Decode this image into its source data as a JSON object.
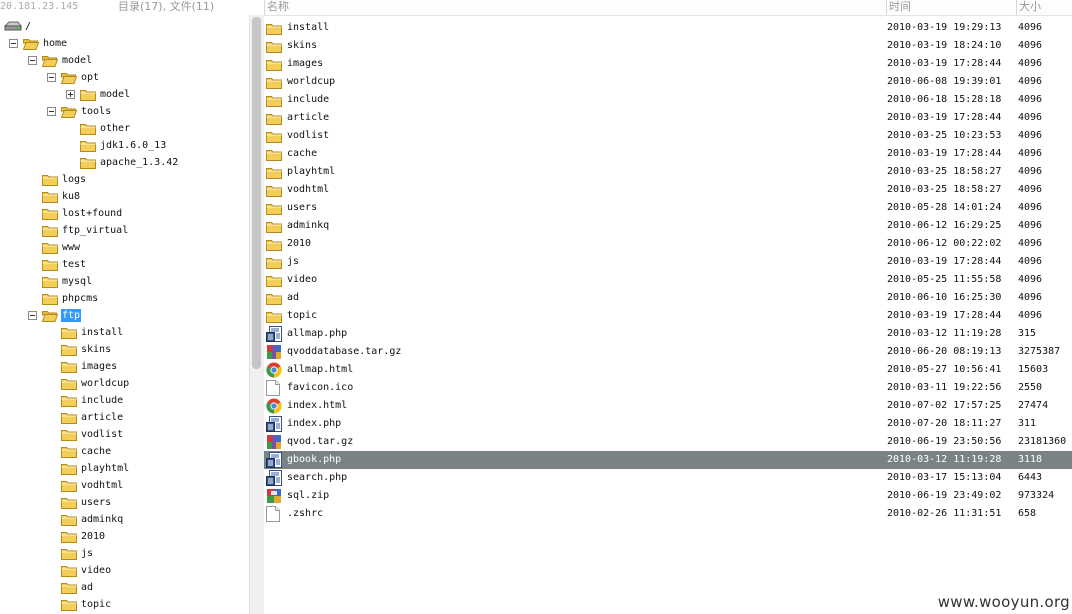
{
  "header": {
    "host_ip": "20.181.23.145",
    "counts": "目录(17), 文件(11)",
    "col_name": "名称",
    "col_time": "时间",
    "col_size": "大小"
  },
  "tree": [
    {
      "label": "/",
      "depth": 0,
      "icon": "drive-icon",
      "toggle": "none"
    },
    {
      "label": "home",
      "depth": 1,
      "icon": "folder-open-icon",
      "toggle": "minus"
    },
    {
      "label": "model",
      "depth": 2,
      "icon": "folder-open-icon",
      "toggle": "minus"
    },
    {
      "label": "opt",
      "depth": 3,
      "icon": "folder-open-icon",
      "toggle": "minus"
    },
    {
      "label": "model",
      "depth": 4,
      "icon": "folder-icon",
      "toggle": "plus"
    },
    {
      "label": "tools",
      "depth": 3,
      "icon": "folder-open-icon",
      "toggle": "minus"
    },
    {
      "label": "other",
      "depth": 4,
      "icon": "folder-icon",
      "toggle": "none"
    },
    {
      "label": "jdk1.6.0_13",
      "depth": 4,
      "icon": "folder-icon",
      "toggle": "none"
    },
    {
      "label": "apache_1.3.42",
      "depth": 4,
      "icon": "folder-icon",
      "toggle": "none"
    },
    {
      "label": "logs",
      "depth": 2,
      "icon": "folder-icon",
      "toggle": "none"
    },
    {
      "label": "ku8",
      "depth": 2,
      "icon": "folder-icon",
      "toggle": "none"
    },
    {
      "label": "lost+found",
      "depth": 2,
      "icon": "folder-icon",
      "toggle": "none"
    },
    {
      "label": "ftp_virtual",
      "depth": 2,
      "icon": "folder-icon",
      "toggle": "none"
    },
    {
      "label": "www",
      "depth": 2,
      "icon": "folder-icon",
      "toggle": "none"
    },
    {
      "label": "test",
      "depth": 2,
      "icon": "folder-icon",
      "toggle": "none"
    },
    {
      "label": "mysql",
      "depth": 2,
      "icon": "folder-icon",
      "toggle": "none"
    },
    {
      "label": "phpcms",
      "depth": 2,
      "icon": "folder-icon",
      "toggle": "none"
    },
    {
      "label": "ftp",
      "depth": 2,
      "icon": "folder-open-icon",
      "toggle": "minus",
      "selected": true
    },
    {
      "label": "install",
      "depth": 3,
      "icon": "folder-icon",
      "toggle": "none"
    },
    {
      "label": "skins",
      "depth": 3,
      "icon": "folder-icon",
      "toggle": "none"
    },
    {
      "label": "images",
      "depth": 3,
      "icon": "folder-icon",
      "toggle": "none"
    },
    {
      "label": "worldcup",
      "depth": 3,
      "icon": "folder-icon",
      "toggle": "none"
    },
    {
      "label": "include",
      "depth": 3,
      "icon": "folder-icon",
      "toggle": "none"
    },
    {
      "label": "article",
      "depth": 3,
      "icon": "folder-icon",
      "toggle": "none"
    },
    {
      "label": "vodlist",
      "depth": 3,
      "icon": "folder-icon",
      "toggle": "none"
    },
    {
      "label": "cache",
      "depth": 3,
      "icon": "folder-icon",
      "toggle": "none"
    },
    {
      "label": "playhtml",
      "depth": 3,
      "icon": "folder-icon",
      "toggle": "none"
    },
    {
      "label": "vodhtml",
      "depth": 3,
      "icon": "folder-icon",
      "toggle": "none"
    },
    {
      "label": "users",
      "depth": 3,
      "icon": "folder-icon",
      "toggle": "none"
    },
    {
      "label": "adminkq",
      "depth": 3,
      "icon": "folder-icon",
      "toggle": "none"
    },
    {
      "label": "2010",
      "depth": 3,
      "icon": "folder-icon",
      "toggle": "none"
    },
    {
      "label": "js",
      "depth": 3,
      "icon": "folder-icon",
      "toggle": "none"
    },
    {
      "label": "video",
      "depth": 3,
      "icon": "folder-icon",
      "toggle": "none"
    },
    {
      "label": "ad",
      "depth": 3,
      "icon": "folder-icon",
      "toggle": "none"
    },
    {
      "label": "topic",
      "depth": 3,
      "icon": "folder-icon",
      "toggle": "none"
    }
  ],
  "files": [
    {
      "name": "install",
      "time": "2010-03-19 19:29:13",
      "size": "4096",
      "icon": "folder-icon"
    },
    {
      "name": "skins",
      "time": "2010-03-19 18:24:10",
      "size": "4096",
      "icon": "folder-icon"
    },
    {
      "name": "images",
      "time": "2010-03-19 17:28:44",
      "size": "4096",
      "icon": "folder-icon"
    },
    {
      "name": "worldcup",
      "time": "2010-06-08 19:39:01",
      "size": "4096",
      "icon": "folder-icon"
    },
    {
      "name": "include",
      "time": "2010-06-18 15:28:18",
      "size": "4096",
      "icon": "folder-icon"
    },
    {
      "name": "article",
      "time": "2010-03-19 17:28:44",
      "size": "4096",
      "icon": "folder-icon"
    },
    {
      "name": "vodlist",
      "time": "2010-03-25 10:23:53",
      "size": "4096",
      "icon": "folder-icon"
    },
    {
      "name": "cache",
      "time": "2010-03-19 17:28:44",
      "size": "4096",
      "icon": "folder-icon"
    },
    {
      "name": "playhtml",
      "time": "2010-03-25 18:58:27",
      "size": "4096",
      "icon": "folder-icon"
    },
    {
      "name": "vodhtml",
      "time": "2010-03-25 18:58:27",
      "size": "4096",
      "icon": "folder-icon"
    },
    {
      "name": "users",
      "time": "2010-05-28 14:01:24",
      "size": "4096",
      "icon": "folder-icon"
    },
    {
      "name": "adminkq",
      "time": "2010-06-12 16:29:25",
      "size": "4096",
      "icon": "folder-icon"
    },
    {
      "name": "2010",
      "time": "2010-06-12 00:22:02",
      "size": "4096",
      "icon": "folder-icon"
    },
    {
      "name": "js",
      "time": "2010-03-19 17:28:44",
      "size": "4096",
      "icon": "folder-icon"
    },
    {
      "name": "video",
      "time": "2010-05-25 11:55:58",
      "size": "4096",
      "icon": "folder-icon"
    },
    {
      "name": "ad",
      "time": "2010-06-10 16:25:30",
      "size": "4096",
      "icon": "folder-icon"
    },
    {
      "name": "topic",
      "time": "2010-03-19 17:28:44",
      "size": "4096",
      "icon": "folder-icon"
    },
    {
      "name": "allmap.php",
      "time": "2010-03-12 11:19:28",
      "size": "315",
      "icon": "php-file-icon"
    },
    {
      "name": "qvoddatabase.tar.gz",
      "time": "2010-06-20 08:19:13",
      "size": "3275387",
      "icon": "archive-file-icon"
    },
    {
      "name": "allmap.html",
      "time": "2010-05-27 10:56:41",
      "size": "15603",
      "icon": "html-file-icon"
    },
    {
      "name": "favicon.ico",
      "time": "2010-03-11 19:22:56",
      "size": "2550",
      "icon": "blank-file-icon"
    },
    {
      "name": "index.html",
      "time": "2010-07-02 17:57:25",
      "size": "27474",
      "icon": "html-file-icon"
    },
    {
      "name": "index.php",
      "time": "2010-07-20 18:11:27",
      "size": "311",
      "icon": "php-file-icon"
    },
    {
      "name": "qvod.tar.gz",
      "time": "2010-06-19 23:50:56",
      "size": "23181360",
      "icon": "archive-file-icon"
    },
    {
      "name": "gbook.php",
      "time": "2010-03-12 11:19:28",
      "size": "3118",
      "icon": "php-file-icon",
      "selected": true
    },
    {
      "name": "search.php",
      "time": "2010-03-17 15:13:04",
      "size": "6443",
      "icon": "php-file-icon"
    },
    {
      "name": "sql.zip",
      "time": "2010-06-19 23:49:02",
      "size": "973324",
      "icon": "zip-file-icon"
    },
    {
      "name": ".zshrc",
      "time": "2010-02-26 11:31:51",
      "size": "658",
      "icon": "blank-file-icon"
    }
  ],
  "watermark": "www.wooyun.org",
  "colors": {
    "selection_list": "#7a8383",
    "selection_tree": "#3399ff",
    "folder": "#f3cf5a"
  }
}
